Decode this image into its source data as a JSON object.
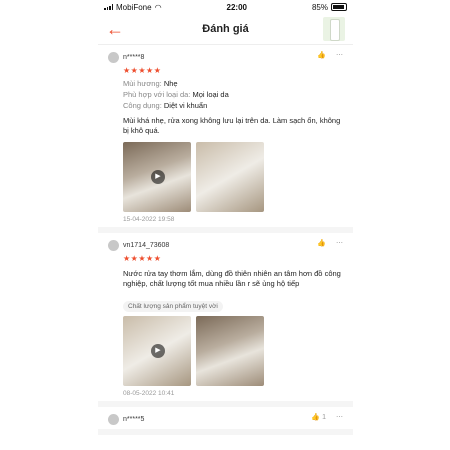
{
  "status": {
    "carrier": "MobiFone",
    "time": "22:00",
    "battery": "85%"
  },
  "header": {
    "title": "Đánh giá"
  },
  "reviews": [
    {
      "user": "n*****8",
      "stars": "★★★★★",
      "attrs": [
        {
          "k": "Mùi hương:",
          "v": "Nhẹ"
        },
        {
          "k": "Phù hợp với loại da:",
          "v": "Mọi loại da"
        },
        {
          "k": "Công dụng:",
          "v": "Diệt vi khuẩn"
        }
      ],
      "text": "Mùi khá nhẹ, rửa xong không lưu lại trên da. Làm sạch ổn, không bị khô quá.",
      "date": "15-04-2022 19:58"
    },
    {
      "user": "vn1714_73608",
      "stars": "★★★★★",
      "text": "Nước rửa tay thơm lắm, dùng đồ thiên nhiên an tâm hơn đồ công nghiệp, chất lượng tốt mua nhiều lần r sẽ ủng hộ tiếp",
      "tag": "Chất lượng sản phẩm tuyệt vời",
      "date": "08-05-2022 10:41"
    },
    {
      "user": "n*****5",
      "likes": "1"
    }
  ],
  "icons": {
    "like": "thumbs-up-icon",
    "more": "more-icon",
    "play": "play-icon",
    "back": "back-arrow-icon"
  }
}
